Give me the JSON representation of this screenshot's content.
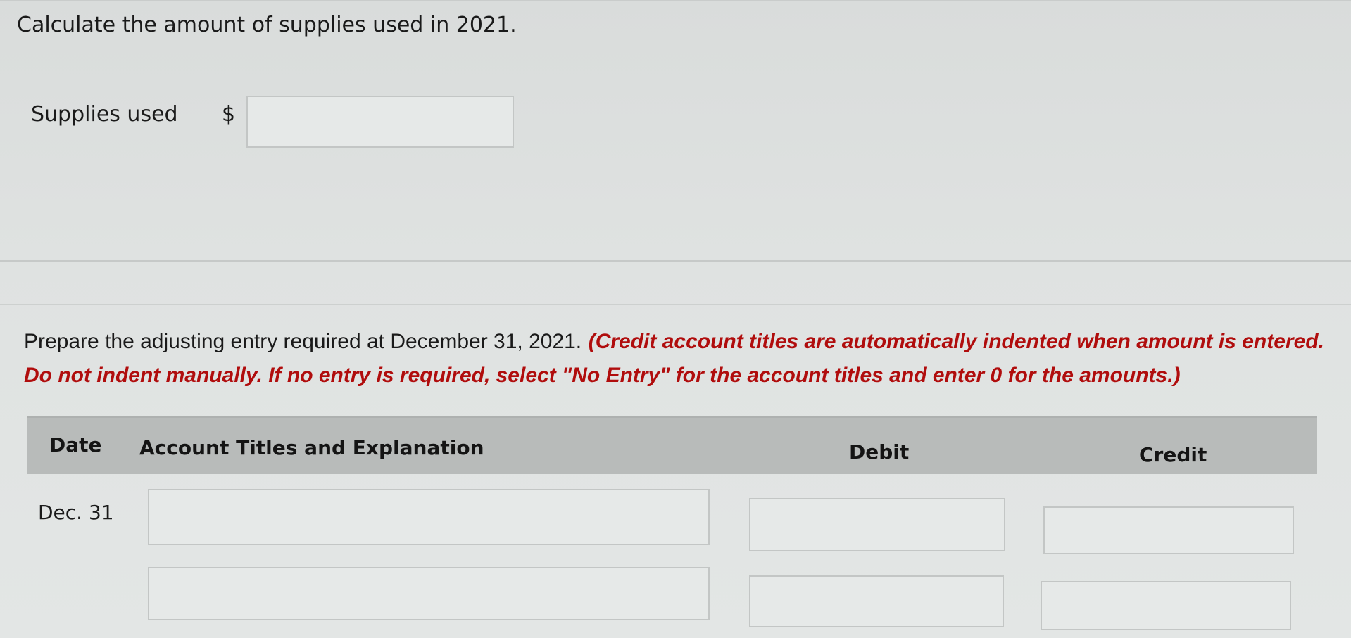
{
  "question1": {
    "text": "Calculate the amount of supplies used in 2021."
  },
  "supplies": {
    "label": "Supplies used",
    "currency": "$",
    "value": ""
  },
  "question2": {
    "text": "Prepare the adjusting entry required at December 31, 2021.",
    "instruction": "(Credit account titles are automatically indented when amount is entered. Do not indent manually. If no entry is required, select \"No Entry\" for the account titles and enter 0 for the amounts.)"
  },
  "colors": {
    "instruction_red": "#b00d0d",
    "header_bg": "#b8bbba"
  },
  "table": {
    "headers": {
      "date": "Date",
      "account": "Account Titles and Explanation",
      "debit": "Debit",
      "credit": "Credit"
    },
    "rows": [
      {
        "date": "Dec. 31",
        "account": "",
        "debit": "",
        "credit": ""
      },
      {
        "date": "",
        "account": "",
        "debit": "",
        "credit": ""
      }
    ]
  }
}
